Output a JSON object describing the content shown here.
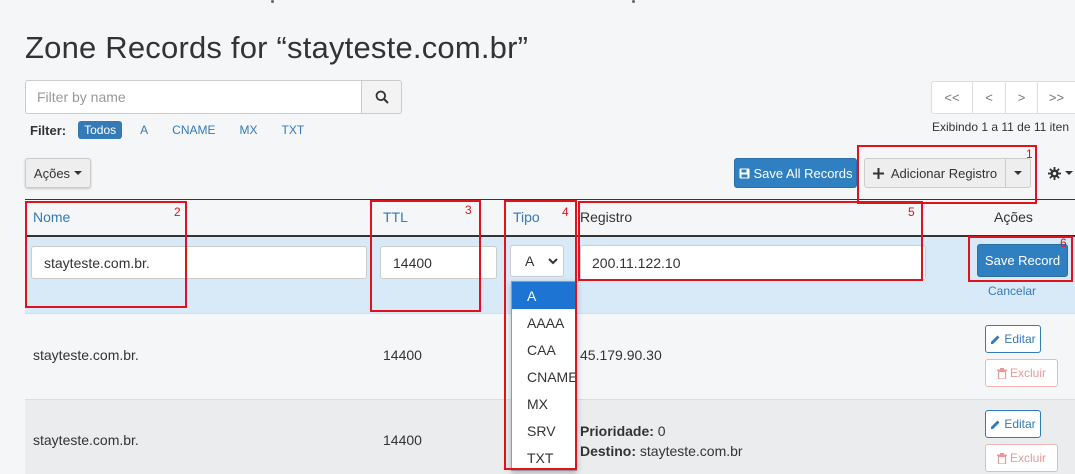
{
  "page": {
    "title": "Zone Records for “stayteste.com.br”"
  },
  "search": {
    "placeholder": "Filter by name"
  },
  "filter": {
    "label": "Filter:",
    "options": [
      "Todos",
      "A",
      "CNAME",
      "MX",
      "TXT"
    ],
    "active": "Todos"
  },
  "pagination": {
    "buttons": [
      "<<",
      "<",
      ">",
      ">>"
    ],
    "info": "Exibindo 1 a 11 de 11 iten"
  },
  "toolbar": {
    "actions_label": "Ações",
    "save_all_label": "Save All Records",
    "add_label": "Adicionar Registro"
  },
  "table": {
    "headers": {
      "name": "Nome",
      "ttl": "TTL",
      "type": "Tipo",
      "record": "Registro",
      "actions": "Ações"
    },
    "edit_row": {
      "name": "stayteste.com.br.",
      "ttl": "14400",
      "type": "A",
      "record": "200.11.122.10",
      "save_label": "Save Record",
      "cancel_label": "Cancelar"
    },
    "rows": [
      {
        "name": "stayteste.com.br.",
        "ttl": "14400",
        "record": "45.179.90.30",
        "edit": "Editar",
        "delete": "Excluir"
      },
      {
        "name": "stayteste.com.br.",
        "ttl": "14400",
        "priority_label": "Prioridade:",
        "priority": "0",
        "dest_label": "Destino:",
        "dest": "stayteste.com.br",
        "edit": "Editar",
        "delete": "Excluir"
      }
    ]
  },
  "type_dropdown": {
    "options": [
      "A",
      "AAAA",
      "CAA",
      "CNAME",
      "MX",
      "SRV",
      "TXT"
    ],
    "selected": "A"
  },
  "annotations": {
    "labels": [
      "1",
      "2",
      "3",
      "4",
      "5",
      "6"
    ],
    "color": "#e0121d"
  },
  "colors": {
    "primary": "#2f7fc1",
    "link": "#337ab7",
    "edit_row_bg": "#d8eaf7",
    "danger": "#e89a9a"
  }
}
